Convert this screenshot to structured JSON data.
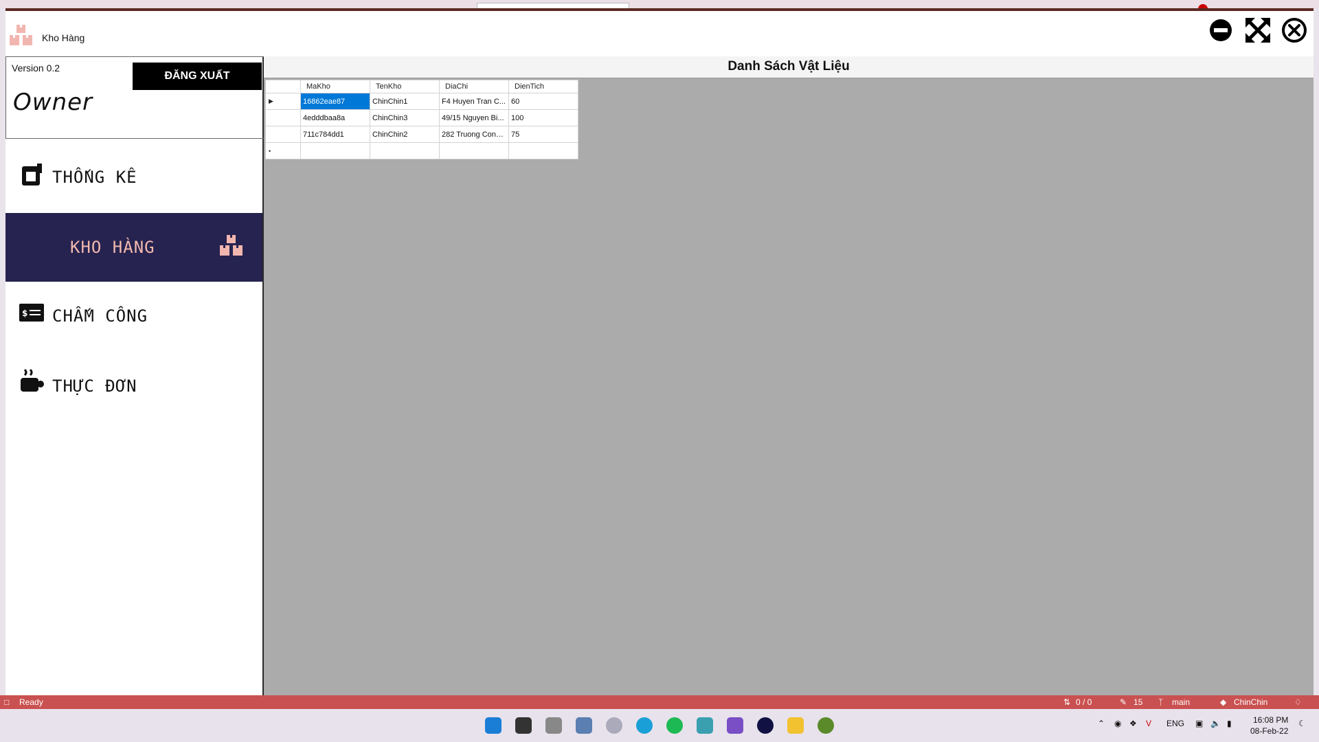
{
  "window": {
    "title": "Kho Hàng"
  },
  "sidebar": {
    "version": "Version 0.2",
    "logout_label": "ĐĂNG XUẤT",
    "role": "Owner",
    "items": [
      {
        "label": "THỐNG KÊ",
        "icon": "chart-box-icon"
      },
      {
        "label": "KHO HÀNG",
        "icon": "boxes-icon",
        "active": true
      },
      {
        "label": "CHẤM CÔNG",
        "icon": "dollar-card-icon"
      },
      {
        "label": "THỰC ĐƠN",
        "icon": "coffee-cup-icon"
      }
    ]
  },
  "main": {
    "title": "Danh Sách Vật Liệu",
    "table": {
      "columns": [
        "MaKho",
        "TenKho",
        "DiaChi",
        "DienTich"
      ],
      "rows": [
        [
          "16862eae87",
          "ChinChin1",
          "F4 Huyen Tran C...",
          "60"
        ],
        [
          "4edddbaa8a",
          "ChinChin3",
          "49/15 Nguyen Bi...",
          "100"
        ],
        [
          "711c784dd1",
          "ChinChin2",
          "282 Truong Cong...",
          "75"
        ]
      ]
    }
  },
  "statusbar": {
    "status": "Ready",
    "changes": "0 / 0",
    "pencil_count": "15",
    "branch": "main",
    "repo": "ChinChin"
  },
  "taskbar": {
    "lang": "ENG",
    "time": "16:08 PM",
    "date": "08-Feb-22"
  },
  "colors": {
    "sidebar_active_bg": "#262350",
    "sidebar_active_fg": "#f3b9ad",
    "statusbar_bg": "#ca5151",
    "selection": "#0078d7"
  }
}
